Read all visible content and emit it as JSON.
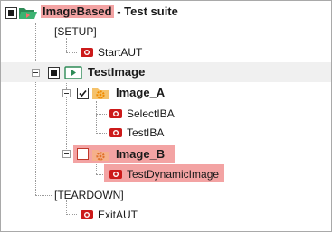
{
  "root": {
    "name": "ImageBased",
    "suffix": " - Test suite"
  },
  "setup": {
    "label": "[SETUP]",
    "action": "StartAUT"
  },
  "test": {
    "label": "TestImage",
    "cases": [
      {
        "label": "Image_A",
        "checked": true,
        "actions": [
          "SelectIBA",
          "TestIBA"
        ]
      },
      {
        "label": "Image_B",
        "checked": false,
        "actions": [
          "TestDynamicImage"
        ]
      }
    ]
  },
  "teardown": {
    "label": "[TEARDOWN]",
    "action": "ExitAUT"
  },
  "colors": {
    "highlight": "#f3a3a3",
    "folder_green": "#2e8b57",
    "gear_orange": "#f0a030",
    "record_red": "#cc1a1a"
  }
}
